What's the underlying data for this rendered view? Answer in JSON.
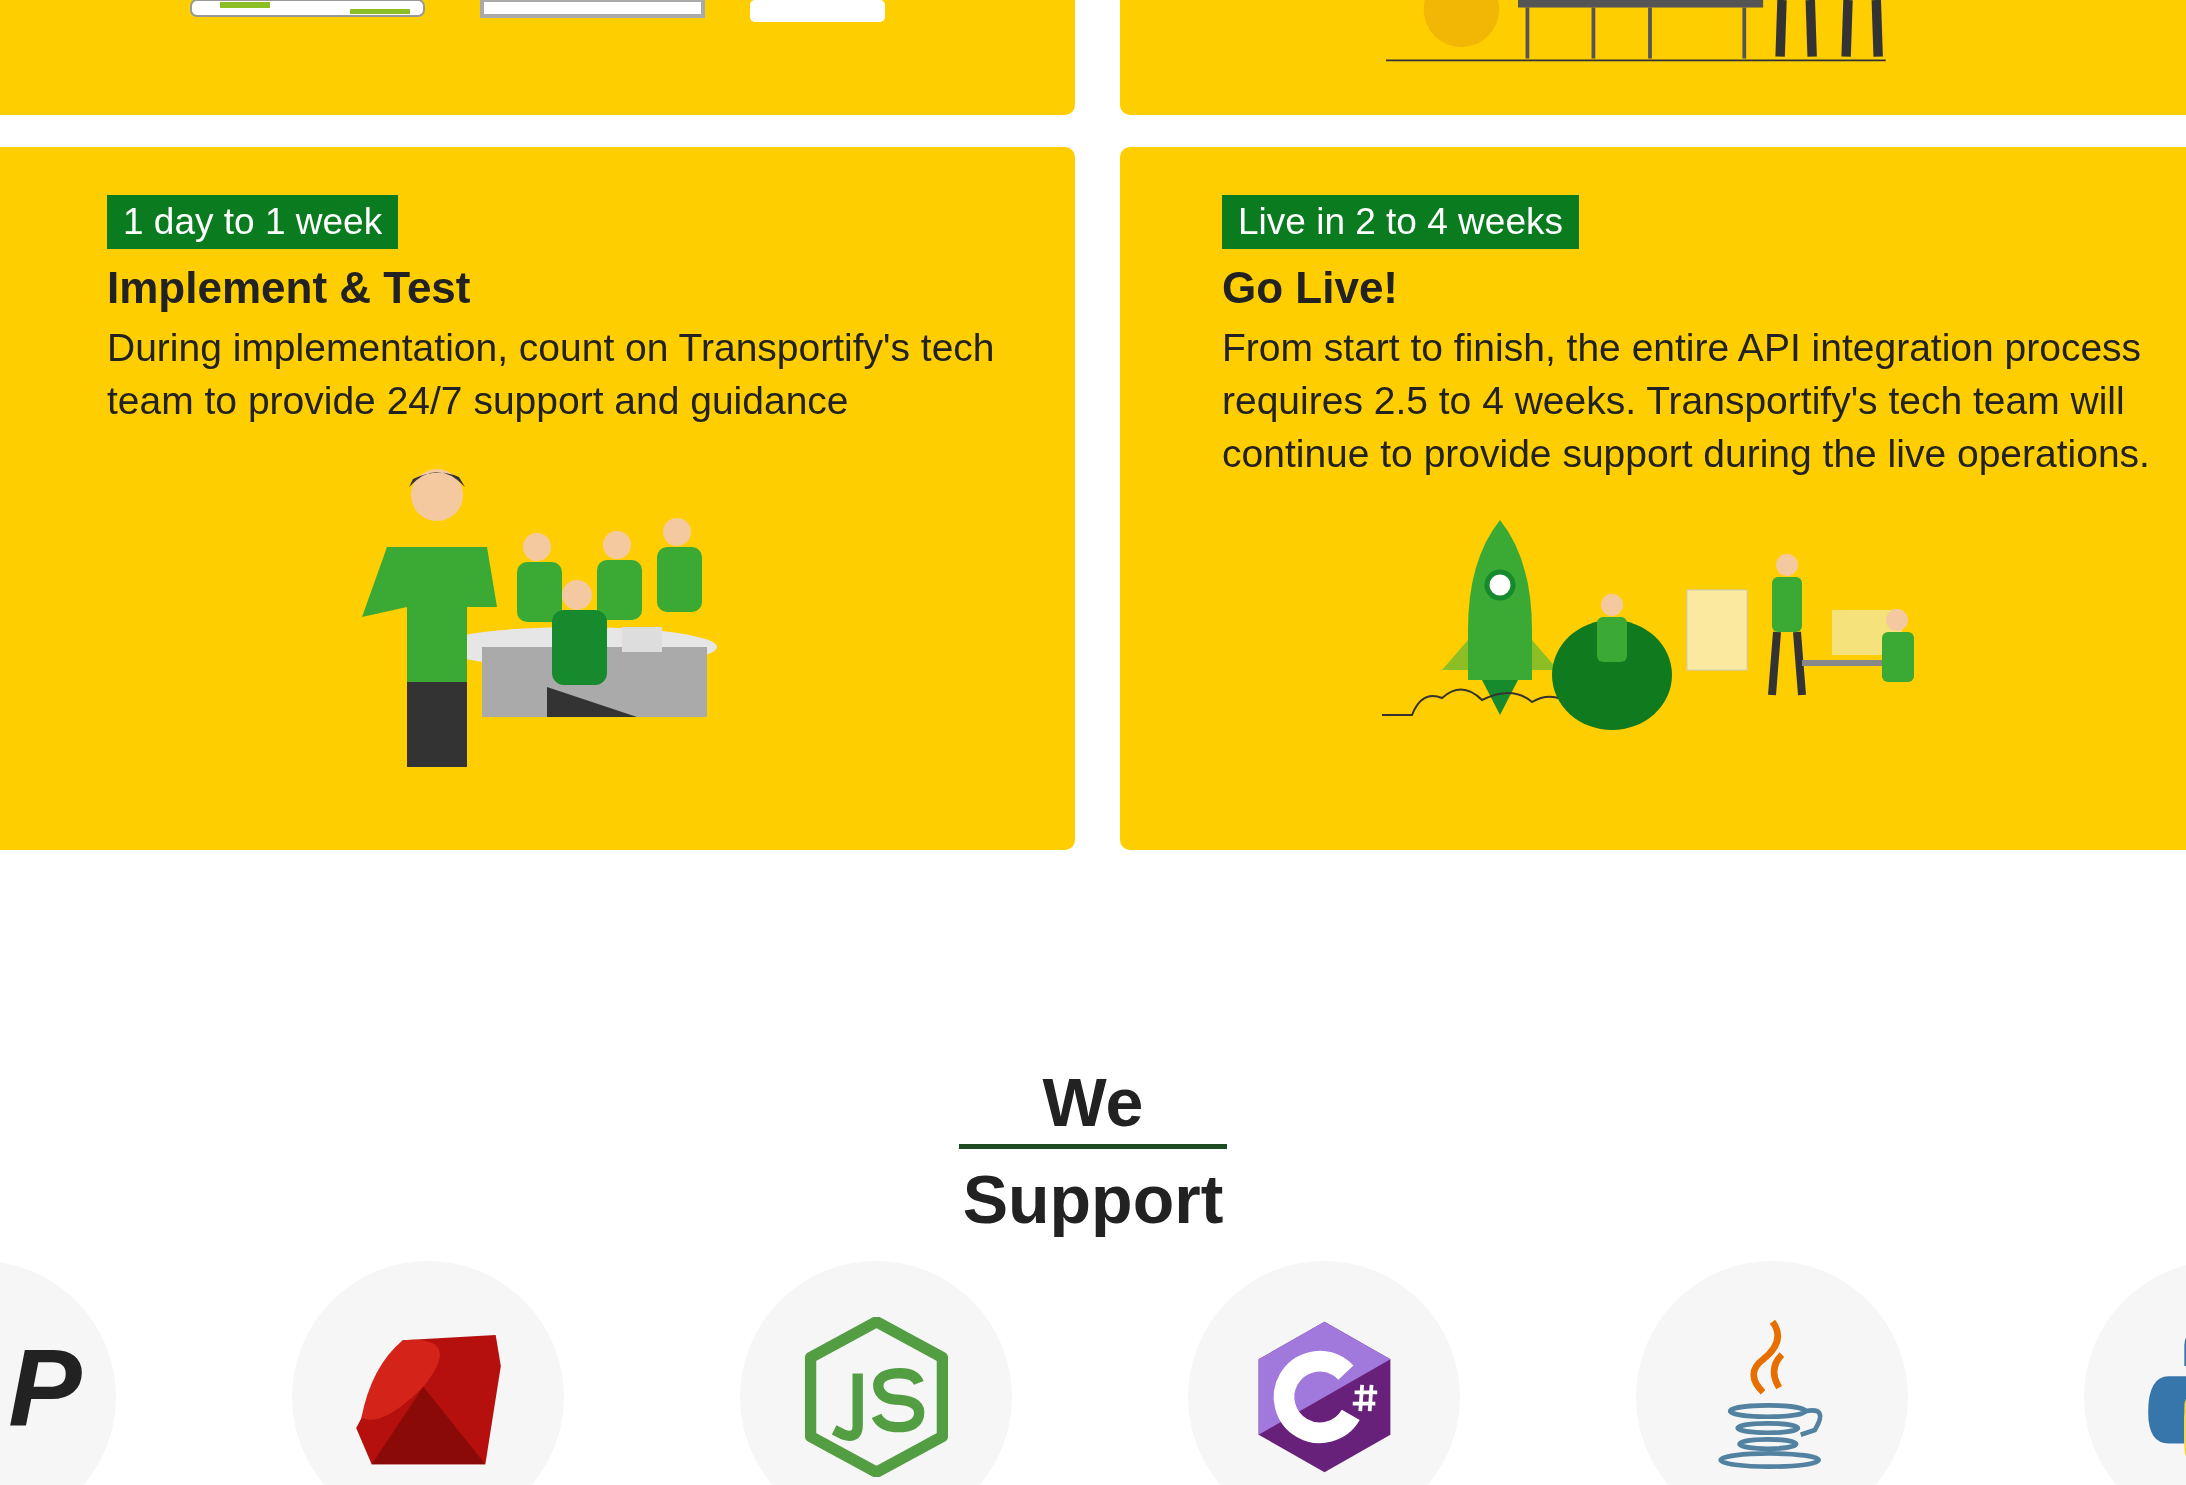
{
  "steps": [
    {
      "kind": "team",
      "badge": "1 day to 1 week",
      "title": "Implement & Test",
      "description": "During implementation, count on Transportify's tech team to provide 24/7 support and guidance"
    },
    {
      "kind": "launch",
      "badge": "Live in 2 to 4 weeks",
      "title": "Go Live!",
      "description": "From start to finish, the entire API integration process requires 2.5 to 4 weeks. Transportify's tech team will continue to provide support during the live operations."
    }
  ],
  "section_heading": {
    "line_1": "We",
    "line_2": "Support"
  },
  "languages": [
    {
      "kind": "php",
      "logo_text": "P"
    },
    {
      "kind": "ruby"
    },
    {
      "kind": "nodejs"
    },
    {
      "kind": "csharp"
    },
    {
      "kind": "java"
    },
    {
      "kind": "python"
    }
  ]
}
